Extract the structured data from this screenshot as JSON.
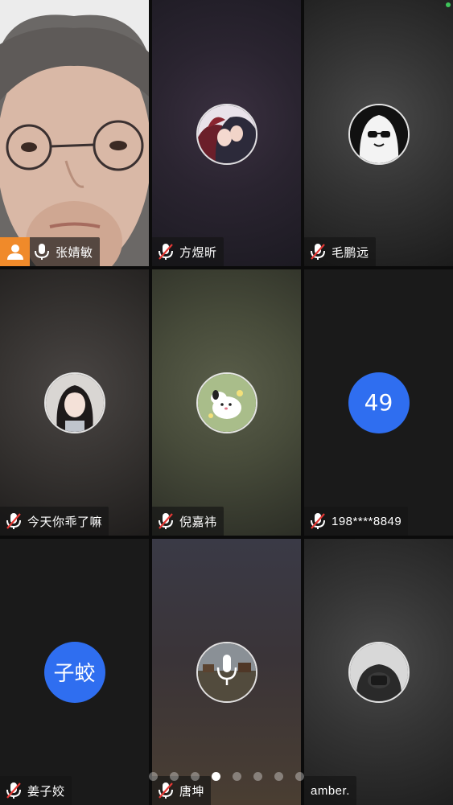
{
  "participants": [
    {
      "name": "张婧敏",
      "muted": false,
      "is_host": true,
      "active_speaker": true,
      "video_on": true
    },
    {
      "name": "方煜昕",
      "muted": true,
      "avatar": "anime-couple-avatar"
    },
    {
      "name": "毛鹏远",
      "muted": true,
      "avatar": "ghost-sunglasses-avatar"
    },
    {
      "name": "今天你乖了嘛",
      "muted": true,
      "avatar": "girl-portrait-avatar"
    },
    {
      "name": "倪嘉祎",
      "muted": true,
      "avatar": "cartoon-dog-avatar"
    },
    {
      "name": "198****8849",
      "muted": true,
      "avatar_text": "49",
      "avatar_color": "#2f6ef0"
    },
    {
      "name": "姜子姣",
      "muted": true,
      "avatar_text": "子蛟",
      "avatar_color": "#2f6ef0"
    },
    {
      "name": "唐坤",
      "muted": true,
      "avatar": "landscape-speaking-avatar"
    },
    {
      "name": "amber.",
      "muted": false,
      "avatar": "dark-photo-avatar"
    }
  ],
  "pager": {
    "count": 8,
    "active_index": 3
  },
  "colors": {
    "host_badge": "#f08a2a",
    "active_border": "#3ec45a",
    "avatar_blue": "#2f6ef0"
  }
}
